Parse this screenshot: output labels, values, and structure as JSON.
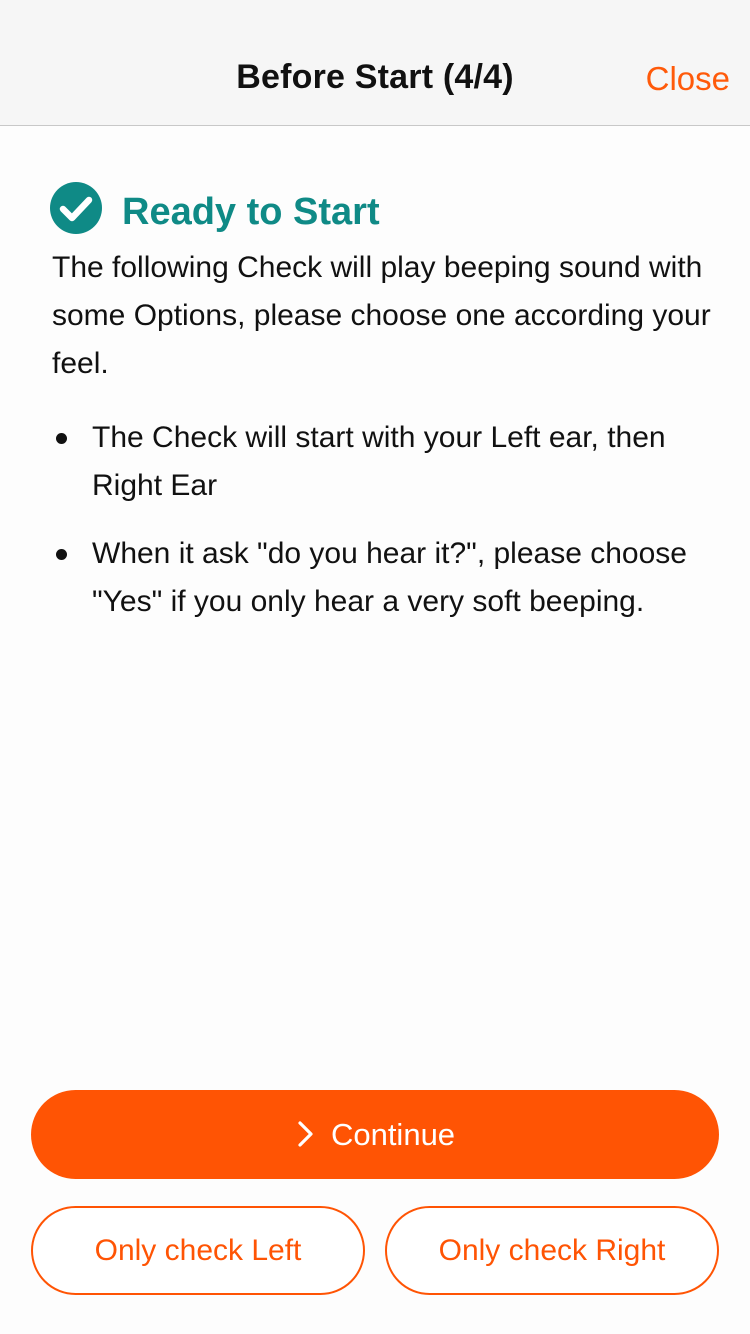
{
  "navbar": {
    "title": "Before Start (4/4)",
    "close_label": "Close"
  },
  "content": {
    "heading_icon": "check-circle-icon",
    "heading": "Ready to Start",
    "intro": "The following Check will play beeping sound with some Options, please choose one according your feel.",
    "bullets": [
      {
        "text": "The Check will start with your Left ear, then Right Ear"
      },
      {
        "text": "When it ask \"do you hear it?\", please choose \"Yes\" if you only hear a very soft beeping."
      }
    ]
  },
  "actions": {
    "continue_icon": "chevron-right-icon",
    "continue_label": "Continue",
    "only_left_label": "Only check Left",
    "only_right_label": "Only check Right"
  },
  "colors": {
    "accent": "#ff5404",
    "heading": "#0f8a86",
    "navbar_bg": "#f6f6f6"
  }
}
